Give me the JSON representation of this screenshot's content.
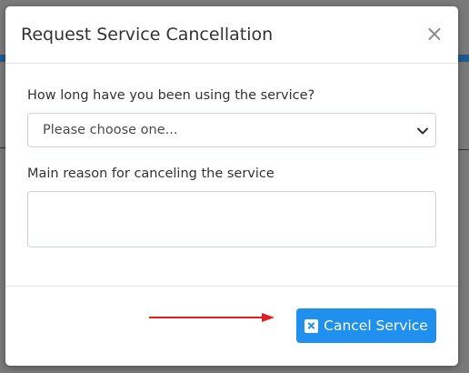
{
  "modal": {
    "title": "Request Service Cancellation",
    "close_label": "×"
  },
  "form": {
    "duration_label": "How long have you been using the service?",
    "duration_selected": "Please choose one...",
    "reason_label": "Main reason for canceling the service",
    "reason_value": ""
  },
  "footer": {
    "cancel_button_label": "Cancel Service"
  },
  "icons": {
    "cancel_button_icon": "close-box-icon",
    "select_caret": "chevron-down-icon",
    "pointer_annotation": "right-arrow-icon"
  },
  "colors": {
    "primary_button": "#1f8ff0",
    "annotation_arrow": "#e02020",
    "backdrop": "#7a7a7a"
  }
}
